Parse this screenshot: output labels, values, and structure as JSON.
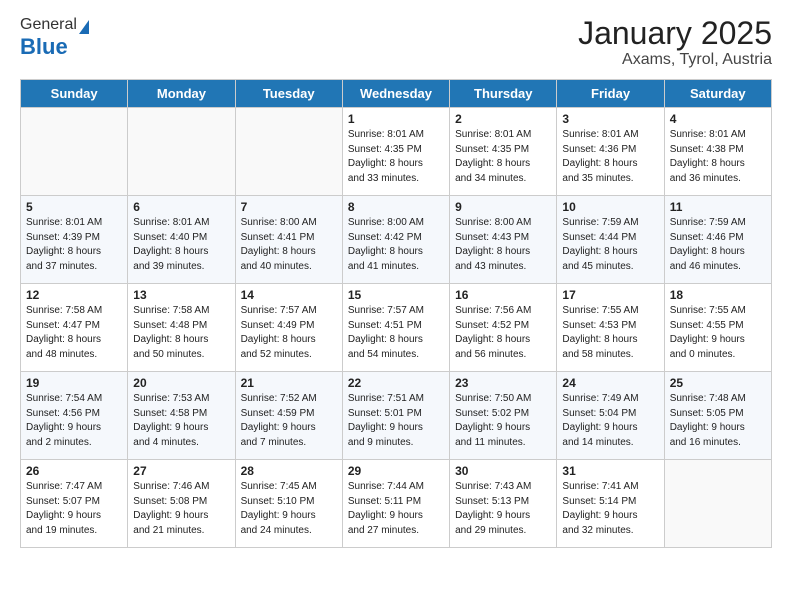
{
  "logo": {
    "general": "General",
    "blue": "Blue"
  },
  "header": {
    "month_year": "January 2025",
    "location": "Axams, Tyrol, Austria"
  },
  "days_of_week": [
    "Sunday",
    "Monday",
    "Tuesday",
    "Wednesday",
    "Thursday",
    "Friday",
    "Saturday"
  ],
  "weeks": [
    [
      {
        "day": "",
        "info": ""
      },
      {
        "day": "",
        "info": ""
      },
      {
        "day": "",
        "info": ""
      },
      {
        "day": "1",
        "info": "Sunrise: 8:01 AM\nSunset: 4:35 PM\nDaylight: 8 hours\nand 33 minutes."
      },
      {
        "day": "2",
        "info": "Sunrise: 8:01 AM\nSunset: 4:35 PM\nDaylight: 8 hours\nand 34 minutes."
      },
      {
        "day": "3",
        "info": "Sunrise: 8:01 AM\nSunset: 4:36 PM\nDaylight: 8 hours\nand 35 minutes."
      },
      {
        "day": "4",
        "info": "Sunrise: 8:01 AM\nSunset: 4:38 PM\nDaylight: 8 hours\nand 36 minutes."
      }
    ],
    [
      {
        "day": "5",
        "info": "Sunrise: 8:01 AM\nSunset: 4:39 PM\nDaylight: 8 hours\nand 37 minutes."
      },
      {
        "day": "6",
        "info": "Sunrise: 8:01 AM\nSunset: 4:40 PM\nDaylight: 8 hours\nand 39 minutes."
      },
      {
        "day": "7",
        "info": "Sunrise: 8:00 AM\nSunset: 4:41 PM\nDaylight: 8 hours\nand 40 minutes."
      },
      {
        "day": "8",
        "info": "Sunrise: 8:00 AM\nSunset: 4:42 PM\nDaylight: 8 hours\nand 41 minutes."
      },
      {
        "day": "9",
        "info": "Sunrise: 8:00 AM\nSunset: 4:43 PM\nDaylight: 8 hours\nand 43 minutes."
      },
      {
        "day": "10",
        "info": "Sunrise: 7:59 AM\nSunset: 4:44 PM\nDaylight: 8 hours\nand 45 minutes."
      },
      {
        "day": "11",
        "info": "Sunrise: 7:59 AM\nSunset: 4:46 PM\nDaylight: 8 hours\nand 46 minutes."
      }
    ],
    [
      {
        "day": "12",
        "info": "Sunrise: 7:58 AM\nSunset: 4:47 PM\nDaylight: 8 hours\nand 48 minutes."
      },
      {
        "day": "13",
        "info": "Sunrise: 7:58 AM\nSunset: 4:48 PM\nDaylight: 8 hours\nand 50 minutes."
      },
      {
        "day": "14",
        "info": "Sunrise: 7:57 AM\nSunset: 4:49 PM\nDaylight: 8 hours\nand 52 minutes."
      },
      {
        "day": "15",
        "info": "Sunrise: 7:57 AM\nSunset: 4:51 PM\nDaylight: 8 hours\nand 54 minutes."
      },
      {
        "day": "16",
        "info": "Sunrise: 7:56 AM\nSunset: 4:52 PM\nDaylight: 8 hours\nand 56 minutes."
      },
      {
        "day": "17",
        "info": "Sunrise: 7:55 AM\nSunset: 4:53 PM\nDaylight: 8 hours\nand 58 minutes."
      },
      {
        "day": "18",
        "info": "Sunrise: 7:55 AM\nSunset: 4:55 PM\nDaylight: 9 hours\nand 0 minutes."
      }
    ],
    [
      {
        "day": "19",
        "info": "Sunrise: 7:54 AM\nSunset: 4:56 PM\nDaylight: 9 hours\nand 2 minutes."
      },
      {
        "day": "20",
        "info": "Sunrise: 7:53 AM\nSunset: 4:58 PM\nDaylight: 9 hours\nand 4 minutes."
      },
      {
        "day": "21",
        "info": "Sunrise: 7:52 AM\nSunset: 4:59 PM\nDaylight: 9 hours\nand 7 minutes."
      },
      {
        "day": "22",
        "info": "Sunrise: 7:51 AM\nSunset: 5:01 PM\nDaylight: 9 hours\nand 9 minutes."
      },
      {
        "day": "23",
        "info": "Sunrise: 7:50 AM\nSunset: 5:02 PM\nDaylight: 9 hours\nand 11 minutes."
      },
      {
        "day": "24",
        "info": "Sunrise: 7:49 AM\nSunset: 5:04 PM\nDaylight: 9 hours\nand 14 minutes."
      },
      {
        "day": "25",
        "info": "Sunrise: 7:48 AM\nSunset: 5:05 PM\nDaylight: 9 hours\nand 16 minutes."
      }
    ],
    [
      {
        "day": "26",
        "info": "Sunrise: 7:47 AM\nSunset: 5:07 PM\nDaylight: 9 hours\nand 19 minutes."
      },
      {
        "day": "27",
        "info": "Sunrise: 7:46 AM\nSunset: 5:08 PM\nDaylight: 9 hours\nand 21 minutes."
      },
      {
        "day": "28",
        "info": "Sunrise: 7:45 AM\nSunset: 5:10 PM\nDaylight: 9 hours\nand 24 minutes."
      },
      {
        "day": "29",
        "info": "Sunrise: 7:44 AM\nSunset: 5:11 PM\nDaylight: 9 hours\nand 27 minutes."
      },
      {
        "day": "30",
        "info": "Sunrise: 7:43 AM\nSunset: 5:13 PM\nDaylight: 9 hours\nand 29 minutes."
      },
      {
        "day": "31",
        "info": "Sunrise: 7:41 AM\nSunset: 5:14 PM\nDaylight: 9 hours\nand 32 minutes."
      },
      {
        "day": "",
        "info": ""
      }
    ]
  ]
}
